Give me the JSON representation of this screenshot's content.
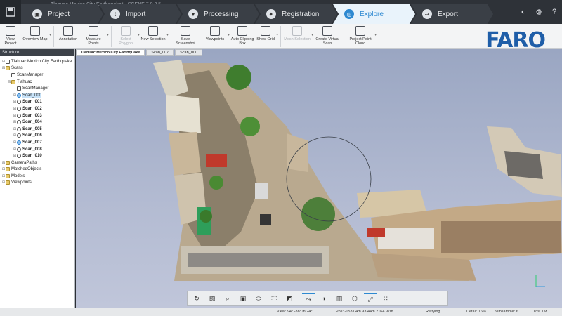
{
  "window": {
    "title": "Tlahuac Mexico City Earthquake* - SCENE 7.0.2.5"
  },
  "tabs": [
    {
      "label": "Project",
      "glyph": "▣"
    },
    {
      "label": "Import",
      "glyph": "⇣"
    },
    {
      "label": "Processing",
      "glyph": "▼"
    },
    {
      "label": "Registration",
      "glyph": "✦"
    },
    {
      "label": "Explore",
      "glyph": "◎"
    },
    {
      "label": "Export",
      "glyph": "⇢"
    }
  ],
  "active_tab": "Explore",
  "ribbon": [
    {
      "label": "View Project"
    },
    {
      "label": "Overview Map",
      "arrow": true
    },
    {
      "label": "Annotation"
    },
    {
      "label": "Measure Points",
      "arrow": true
    },
    {
      "label": "Select Polygon",
      "disabled": true,
      "arrow": true
    },
    {
      "label": "New Selection",
      "arrow": true
    },
    {
      "label": "Save Screenshot"
    },
    {
      "label": "Viewpoints",
      "arrow": true
    },
    {
      "label": "Auto Clipping Box"
    },
    {
      "label": "Show Grid",
      "arrow": true
    },
    {
      "label": "Mesh Selection",
      "disabled": true,
      "arrow": true
    },
    {
      "label": "Create Virtual Scan"
    },
    {
      "label": "Project Point Cloud",
      "arrow": true
    }
  ],
  "brand": {
    "logo_text": "FARO",
    "color": "#1f5ea8"
  },
  "panel": {
    "title": "Structure",
    "tree": [
      {
        "label": "Tlahuac Mexico City Earthquake",
        "depth": 0,
        "icon": "project"
      },
      {
        "label": "Scans",
        "depth": 0,
        "icon": "folder"
      },
      {
        "label": "ScanManager",
        "depth": 1,
        "icon": "manager"
      },
      {
        "label": "Tlahuac",
        "depth": 1,
        "icon": "folder"
      },
      {
        "label": "ScanManager",
        "depth": 2,
        "icon": "manager"
      },
      {
        "label": "Scan_000",
        "depth": 2,
        "icon": "scan-blue",
        "selected": true
      },
      {
        "label": "Scan_001",
        "depth": 2,
        "icon": "scan",
        "bold": true
      },
      {
        "label": "Scan_002",
        "depth": 2,
        "icon": "scan",
        "bold": true
      },
      {
        "label": "Scan_003",
        "depth": 2,
        "icon": "scan",
        "bold": true
      },
      {
        "label": "Scan_004",
        "depth": 2,
        "icon": "scan",
        "bold": true
      },
      {
        "label": "Scan_005",
        "depth": 2,
        "icon": "scan",
        "bold": true
      },
      {
        "label": "Scan_006",
        "depth": 2,
        "icon": "scan",
        "bold": true
      },
      {
        "label": "Scan_007",
        "depth": 2,
        "icon": "scan-blue",
        "bold": true
      },
      {
        "label": "Scan_008",
        "depth": 2,
        "icon": "scan",
        "bold": true
      },
      {
        "label": "Scan_010",
        "depth": 2,
        "icon": "scan",
        "bold": true
      },
      {
        "label": "CameraPaths",
        "depth": 0,
        "icon": "folder"
      },
      {
        "label": "MatchedObjects",
        "depth": 0,
        "icon": "folder"
      },
      {
        "label": "Models",
        "depth": 0,
        "icon": "folder"
      },
      {
        "label": "Viewpoints",
        "depth": 0,
        "icon": "folder"
      }
    ]
  },
  "view_tabs": [
    {
      "label": "Tlahuac Mexico City Earthquake",
      "active": true
    },
    {
      "label": "Scan_007",
      "active": false
    },
    {
      "label": "Scan_000",
      "active": false
    }
  ],
  "view_toolbar": [
    {
      "icon": "orbit-icon",
      "glyph": "↻"
    },
    {
      "icon": "cube-stack-icon",
      "glyph": "▧"
    },
    {
      "icon": "zoom-icon",
      "glyph": "⌕"
    },
    {
      "icon": "box-icon",
      "glyph": "▣"
    },
    {
      "icon": "ellipse-icon",
      "glyph": "⬭"
    },
    {
      "icon": "slice-icon",
      "glyph": "⬚"
    },
    {
      "icon": "clip-icon",
      "glyph": "◩"
    },
    {
      "icon": "walk-icon",
      "glyph": "⤳",
      "on": true
    },
    {
      "icon": "sphere-icon",
      "glyph": "◑"
    },
    {
      "icon": "section-icon",
      "glyph": "▥"
    },
    {
      "icon": "cube-icon",
      "glyph": "⬡"
    },
    {
      "icon": "expand-icon",
      "glyph": "⤢",
      "on": true
    },
    {
      "icon": "grid-icon",
      "glyph": "∷"
    }
  ],
  "status": {
    "view": "View: 94° -38° in 24°",
    "pos": "Pos: -153.04m 93.44m 2164.97m",
    "retrying": "Retrying...",
    "detail": "Detail: 16%",
    "subsample": "Subsample: 6",
    "pts": "Pts: 1M"
  }
}
